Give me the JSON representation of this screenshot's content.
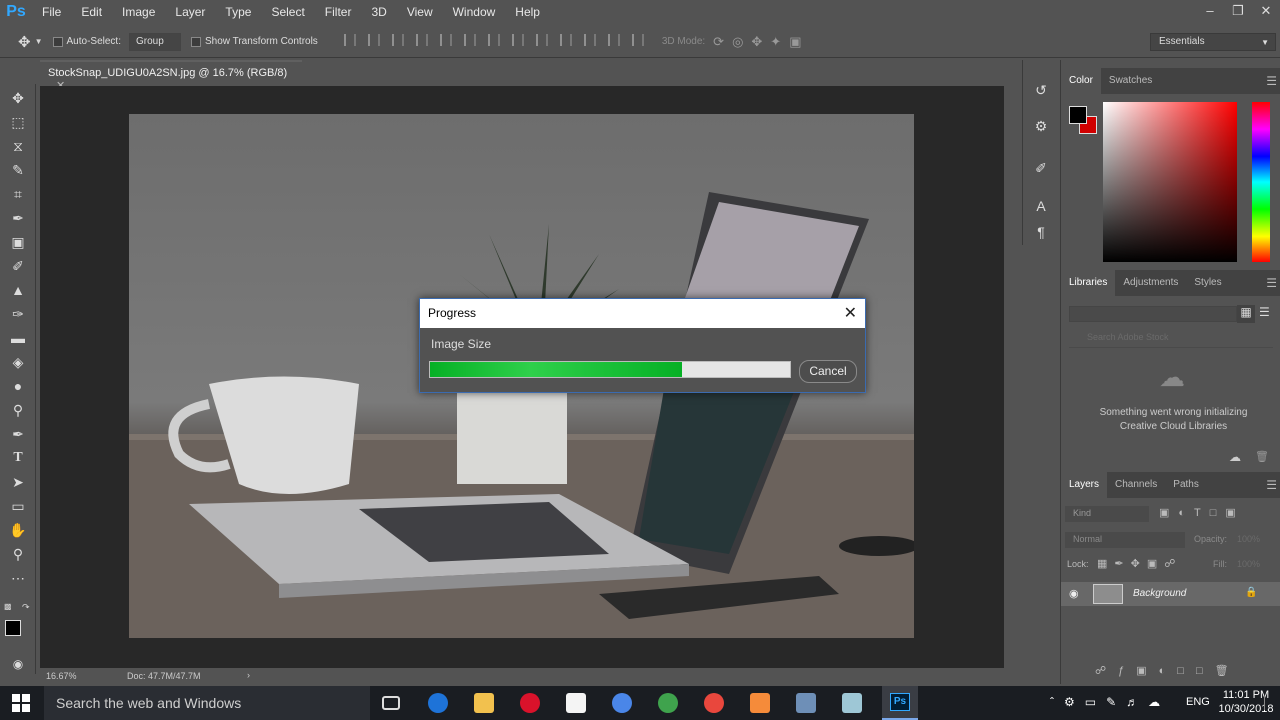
{
  "app": {
    "logo": "Ps",
    "name": "Photoshop"
  },
  "menu": [
    "File",
    "Edit",
    "Image",
    "Layer",
    "Type",
    "Select",
    "Filter",
    "3D",
    "View",
    "Window",
    "Help"
  ],
  "options": {
    "auto_select": "Auto-Select:",
    "group_value": "Group",
    "show_transform": "Show Transform Controls",
    "mode_3d": "3D Mode:",
    "workspace": "Essentials"
  },
  "document": {
    "tab_title": "StockSnap_UDIGU0A2SN.jpg @ 16.7% (RGB/8)",
    "zoom": "16.67%",
    "doc_size": "Doc: 47.7M/47.7M"
  },
  "dialog": {
    "title": "Progress",
    "label": "Image Size",
    "progress": 0.7,
    "cancel": "Cancel"
  },
  "panels": {
    "color_tabs": [
      "Color",
      "Swatches"
    ],
    "library_tabs": [
      "Libraries",
      "Adjustments",
      "Styles"
    ],
    "library_search_placeholder": "Search Adobe Stock",
    "library_message": "Something went wrong initializing Creative Cloud Libraries",
    "layer_tabs": [
      "Layers",
      "Channels",
      "Paths"
    ],
    "kind": "Kind",
    "blend_mode": "Normal",
    "opacity_label": "Opacity:",
    "opacity_value": "100%",
    "lock_label": "Lock:",
    "fill_label": "Fill:",
    "fill_value": "100%",
    "layer_name": "Background"
  },
  "taskbar": {
    "search": "Search the web and Windows",
    "language": "ENG",
    "time": "11:01 PM",
    "date": "10/30/2018"
  },
  "colors": {
    "accent": "#31a8ff",
    "progress": "#06b025",
    "foreground": "#000000",
    "background": "#d00000"
  }
}
